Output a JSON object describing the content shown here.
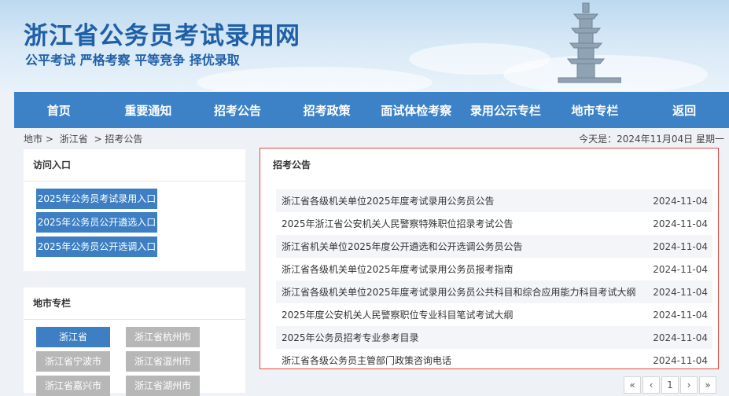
{
  "header": {
    "title": "浙江省公务员考试录用网",
    "slogan": "公平考试 严格考察 平等竞争 择优录取"
  },
  "nav": [
    "首页",
    "重要通知",
    "招考公告",
    "招考政策",
    "面试体检考察",
    "录用公示专栏",
    "地市专栏",
    "返回"
  ],
  "breadcrumb": [
    "地市 >",
    "浙江省",
    "> 招考公告"
  ],
  "today": "今天是：2024年11月04日 星期一",
  "access": {
    "title": "访问入口",
    "buttons": [
      "2025年公务员考试录用入口",
      "2025年公务员公开遴选入口",
      "2025年公务员公开选调入口"
    ]
  },
  "cities": {
    "title": "地市专栏",
    "buttons": [
      "浙江省",
      "浙江省杭州市",
      "浙江省宁波市",
      "浙江省温州市",
      "浙江省嘉兴市",
      "浙江省湖州市"
    ]
  },
  "notices": {
    "title": "招考公告",
    "rows": [
      {
        "title": "浙江省各级机关单位2025年度考试录用公务员公告",
        "date": "2024-11-04"
      },
      {
        "title": "2025年浙江省公安机关人民警察特殊职位招录考试公告",
        "date": "2024-11-04"
      },
      {
        "title": "浙江省机关单位2025年度公开遴选和公开选调公务员公告",
        "date": "2024-11-04"
      },
      {
        "title": "浙江省各级机关单位2025年度考试录用公务员报考指南",
        "date": "2024-11-04"
      },
      {
        "title": "浙江省各级机关单位2025年度考试录用公务员公共科目和综合应用能力科目考试大纲",
        "date": "2024-11-04"
      },
      {
        "title": "2025年度公安机关人民警察职位专业科目笔试考试大纲",
        "date": "2024-11-04"
      },
      {
        "title": "2025年公务员招考专业参考目录",
        "date": "2024-11-04"
      },
      {
        "title": "浙江省各级公务员主管部门政策咨询电话",
        "date": "2024-11-04"
      }
    ]
  },
  "pager": [
    "«",
    "‹",
    "1",
    "›",
    "»"
  ]
}
